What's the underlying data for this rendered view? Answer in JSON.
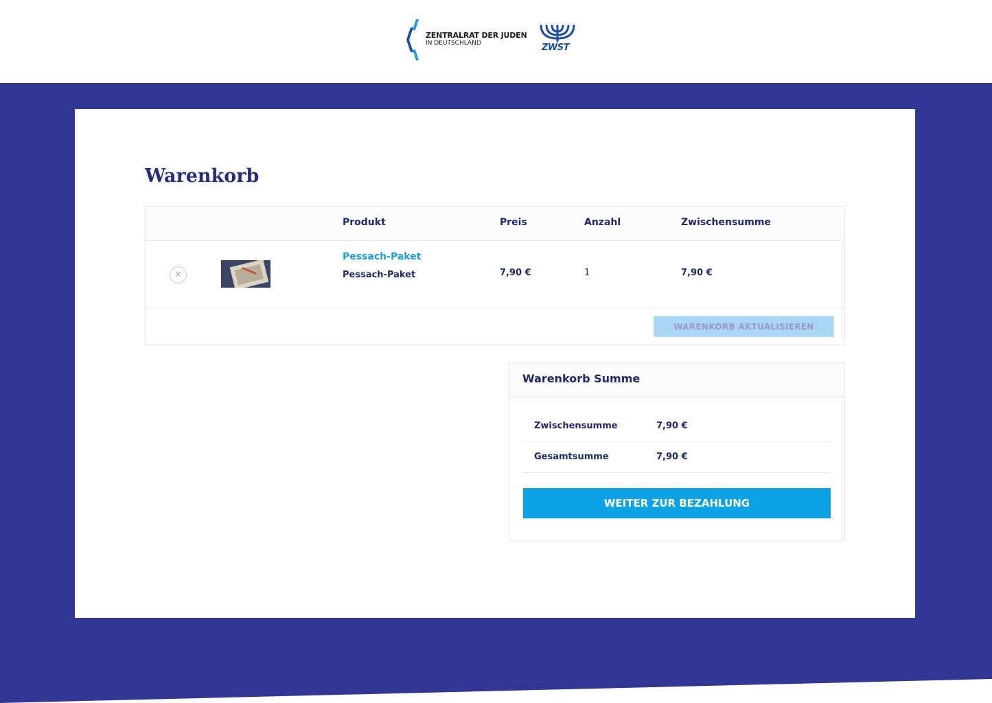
{
  "header": {
    "logo_zentralrat": {
      "line1": "ZENTRALRAT DER JUDEN",
      "line2": "IN DEUTSCHLAND",
      "icon": "zentralrat-logo-icon"
    },
    "logo_zwst": {
      "text": "ZWST",
      "icon": "menorah-icon"
    }
  },
  "colors": {
    "brand_blue": "#323694",
    "accent_cyan": "#0ca2e4",
    "link_cyan": "#1b9fdc",
    "text_navy": "#1f2a6b"
  },
  "cart": {
    "title": "Warenkorb",
    "columns": [
      "",
      "",
      "Produkt",
      "Preis",
      "Anzahl",
      "Zwischensumme"
    ],
    "items": [
      {
        "remove_icon": "close-icon",
        "product_name": "Pessach-Paket",
        "product_subtitle": "Pessach-Paket",
        "price": "7,90 €",
        "quantity": "1",
        "subtotal": "7,90 €"
      }
    ],
    "update_button": "WARENKORB AKTUALISIEREN"
  },
  "totals": {
    "title": "Warenkorb Summe",
    "rows": [
      {
        "label": "Zwischensumme",
        "value": "7,90 €"
      },
      {
        "label": "Gesamtsumme",
        "value": "7,90 €"
      }
    ],
    "checkout_button": "WEITER ZUR BEZAHLUNG"
  }
}
